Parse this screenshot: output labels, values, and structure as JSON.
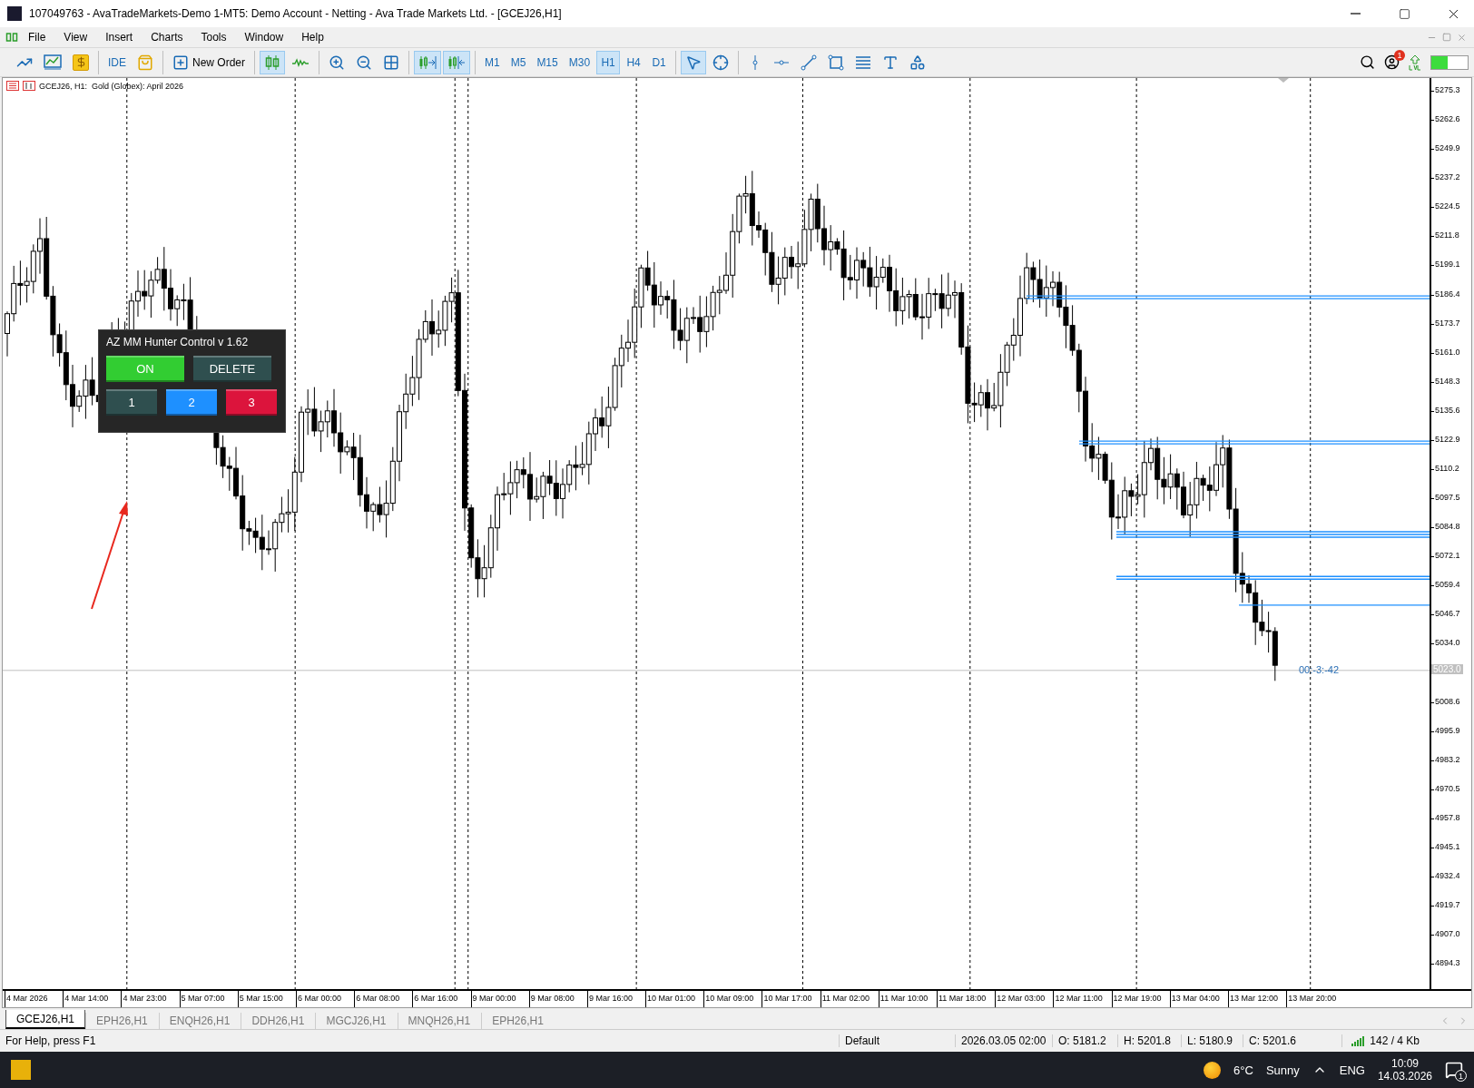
{
  "window": {
    "title": "107049763 - AvaTradeMarkets-Demo 1-MT5: Demo Account - Netting - Ava Trade Markets Ltd. - [GCEJ26,H1]"
  },
  "menu": [
    "File",
    "View",
    "Insert",
    "Charts",
    "Tools",
    "Window",
    "Help"
  ],
  "toolbar": {
    "groups": [
      [
        {
          "kind": "line-chart",
          "selected": false
        },
        {
          "kind": "indicators",
          "selected": false
        },
        {
          "kind": "market",
          "selected": false
        }
      ],
      [
        {
          "kind": "ide",
          "label": "IDE",
          "selected": false
        },
        {
          "kind": "shop",
          "selected": false
        }
      ],
      [
        {
          "kind": "new-order",
          "label": "New Order",
          "selected": false
        }
      ],
      [
        {
          "kind": "candles",
          "selected": true
        },
        {
          "kind": "ticks"
        }
      ],
      [
        {
          "kind": "zoom-in",
          "selected": false
        },
        {
          "kind": "zoom-out",
          "selected": false
        },
        {
          "kind": "tile",
          "selected": false
        }
      ],
      [
        {
          "kind": "autoscroll",
          "selected": true
        },
        {
          "kind": "chart-shift",
          "selected": true
        }
      ],
      [
        {
          "kind": "timeframe",
          "label": "M1",
          "selected": false
        },
        {
          "kind": "timeframe",
          "label": "M5",
          "selected": false
        },
        {
          "kind": "timeframe",
          "label": "M15",
          "selected": false
        },
        {
          "kind": "timeframe",
          "label": "M30",
          "selected": false
        },
        {
          "kind": "timeframe",
          "label": "H1",
          "selected": true
        },
        {
          "kind": "timeframe",
          "label": "H4",
          "selected": false
        },
        {
          "kind": "timeframe",
          "label": "D1",
          "selected": false
        }
      ],
      [
        {
          "kind": "cursor",
          "selected": true
        },
        {
          "kind": "crosshair",
          "selected": false
        }
      ],
      [
        {
          "kind": "vline",
          "selected": false
        },
        {
          "kind": "hline",
          "selected": false
        },
        {
          "kind": "trendline",
          "selected": false
        },
        {
          "kind": "rect",
          "selected": false
        },
        {
          "kind": "fibo",
          "selected": false
        },
        {
          "kind": "text",
          "selected": false
        },
        {
          "kind": "shapes",
          "selected": false
        }
      ]
    ],
    "notification_count": "1"
  },
  "chart": {
    "symbol_label": "GCEJ26, H1:  Gold (Globex): April 2026",
    "price_ticks": [
      "5275.3",
      "5262.6",
      "5249.9",
      "5237.2",
      "5224.5",
      "5211.8",
      "5199.1",
      "5186.4",
      "5173.7",
      "5161.0",
      "5148.3",
      "5135.6",
      "5122.9",
      "5110.2",
      "5097.5",
      "5084.8",
      "5072.1",
      "5059.4",
      "5046.7",
      "5034.0",
      "5008.6",
      "4995.9",
      "4983.2",
      "4970.5",
      "4957.8",
      "4945.1",
      "4932.4",
      "4919.7",
      "4907.0",
      "4894.3"
    ],
    "current_price": "5023.0",
    "countdown": "00:-3:-42",
    "time_labels": [
      "4 Mar 2026",
      "4 Mar 14:00",
      "4 Mar 23:00",
      "5 Mar 07:00",
      "5 Mar 15:00",
      "6 Mar 00:00",
      "6 Mar 08:00",
      "6 Mar 16:00",
      "9 Mar 00:00",
      "9 Mar 08:00",
      "9 Mar 16:00",
      "10 Mar 01:00",
      "10 Mar 09:00",
      "10 Mar 17:00",
      "11 Mar 02:00",
      "11 Mar 10:00",
      "11 Mar 18:00",
      "12 Mar 03:00",
      "12 Mar 11:00",
      "12 Mar 19:00",
      "13 Mar 04:00",
      "13 Mar 12:00",
      "13 Mar 20:00"
    ]
  },
  "panel": {
    "title": "AZ MM Hunter Control v 1.62",
    "buttons": [
      {
        "label": "ON",
        "color": "#32cd32"
      },
      {
        "label": "DELETE",
        "color": "#2f4f4f"
      },
      {
        "label": "1",
        "color": "#2f4f4f"
      },
      {
        "label": "2",
        "color": "#1e90ff"
      },
      {
        "label": "3",
        "color": "#dc143c"
      }
    ]
  },
  "tabs": [
    {
      "label": "GCEJ26,H1",
      "selected": true
    },
    {
      "label": "EPH26,H1",
      "selected": false
    },
    {
      "label": "ENQH26,H1",
      "selected": false
    },
    {
      "label": "DDH26,H1",
      "selected": false
    },
    {
      "label": "MGCJ26,H1",
      "selected": false
    },
    {
      "label": "MNQH26,H1",
      "selected": false
    },
    {
      "label": "EPH26,H1",
      "selected": false
    }
  ],
  "status_bar": {
    "help": "For Help, press F1",
    "profile": "Default",
    "time": "2026.03.05 02:00",
    "open": "O: 5181.2",
    "high": "H: 5201.8",
    "low": "L: 5180.9",
    "close": "C: 5201.6",
    "traffic": "142 / 4 Kb"
  },
  "taskbar": {
    "temperature": "6°C",
    "weather": "Sunny",
    "language": "ENG",
    "time": "10:09",
    "date": "14.03.2026",
    "notification_count": "1"
  }
}
